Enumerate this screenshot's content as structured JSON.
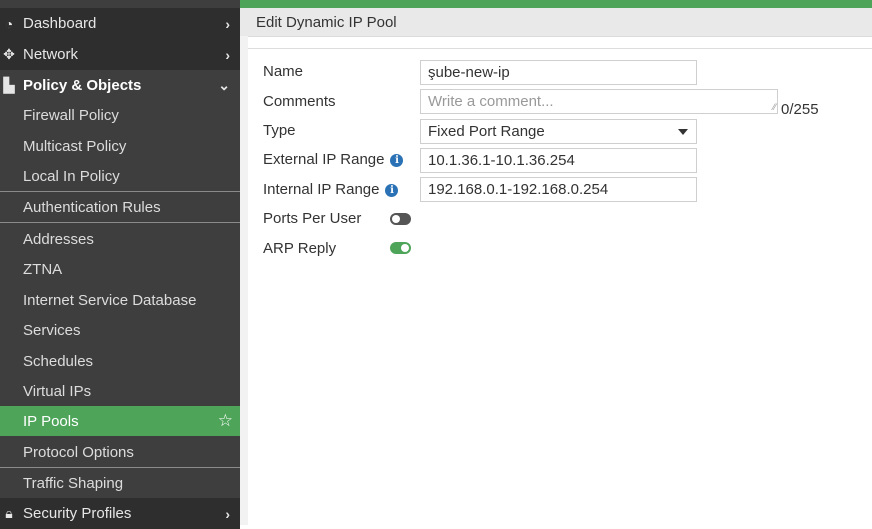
{
  "sidebar": {
    "top_items": [
      {
        "label": "Dashboard",
        "icon": "dashboard-icon"
      },
      {
        "label": "Network",
        "icon": "network-move-icon"
      },
      {
        "label": "Policy & Objects",
        "icon": "policy-icon"
      }
    ],
    "sub_items": [
      {
        "label": "Firewall Policy"
      },
      {
        "label": "Multicast Policy"
      },
      {
        "label": "Local In Policy"
      },
      {
        "label": "Authentication Rules"
      },
      {
        "label": "Addresses"
      },
      {
        "label": "ZTNA"
      },
      {
        "label": "Internet Service Database"
      },
      {
        "label": "Services"
      },
      {
        "label": "Schedules"
      },
      {
        "label": "Virtual IPs"
      },
      {
        "label": "IP Pools",
        "active": true
      },
      {
        "label": "Protocol Options"
      },
      {
        "label": "Traffic Shaping"
      }
    ],
    "bottom_item": {
      "label": "Security Profiles",
      "icon": "lock-icon"
    },
    "active_color": "#4ea55a"
  },
  "header": {
    "title": "Edit Dynamic IP Pool"
  },
  "form": {
    "name_label": "Name",
    "name_value": "şube-new-ip",
    "comments_label": "Comments",
    "comments_placeholder": "Write a comment...",
    "comments_counter": "0/255",
    "type_label": "Type",
    "type_value": "Fixed Port Range",
    "external_label": "External IP Range",
    "external_value": "10.1.36.1-10.1.36.254",
    "internal_label": "Internal IP Range",
    "internal_value": "192.168.0.1-192.168.0.254",
    "ports_per_user_label": "Ports Per User",
    "ports_per_user_enabled": false,
    "arp_reply_label": "ARP Reply",
    "arp_reply_enabled": true
  }
}
